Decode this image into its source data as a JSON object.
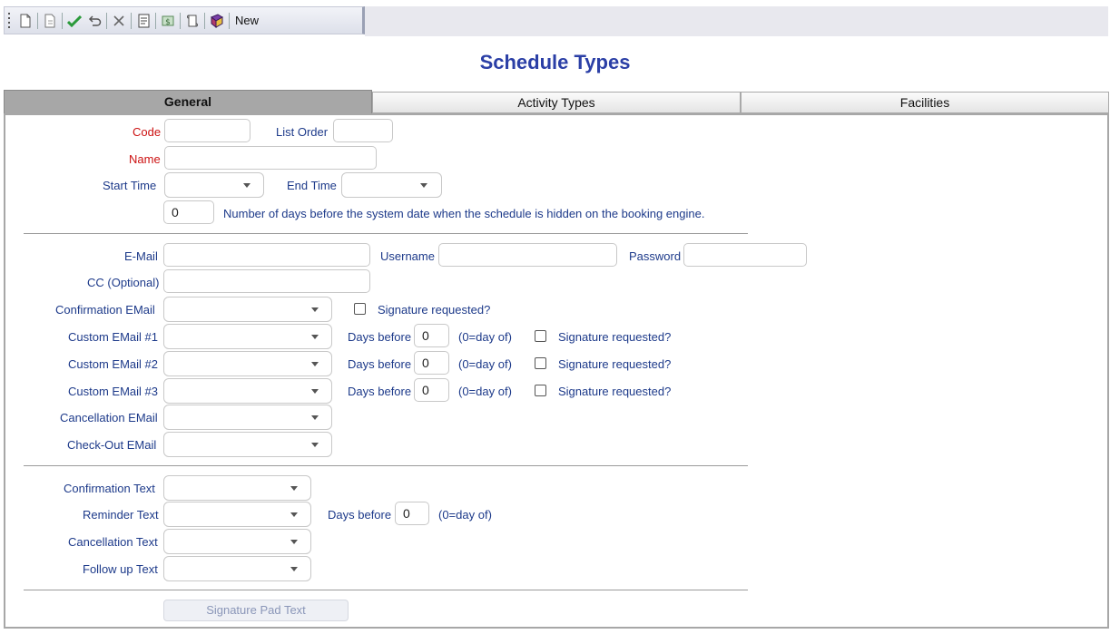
{
  "toolbar": {
    "icons": [
      "new-document-icon",
      "copy-document-icon",
      "save-check-icon",
      "undo-icon",
      "delete-icon",
      "report-icon",
      "money-icon",
      "history-icon",
      "help-book-icon"
    ],
    "new_label": "New"
  },
  "page_title": "Schedule Types",
  "tabs": [
    {
      "label": "General",
      "active": true
    },
    {
      "label": "Activity Types",
      "active": false
    },
    {
      "label": "Facilities",
      "active": false
    }
  ],
  "general": {
    "code_label": "Code",
    "list_order_label": "List Order",
    "name_label": "Name",
    "start_time_label": "Start Time",
    "end_time_label": "End Time",
    "hidden_days_value": "0",
    "hidden_days_text": "Number of days before the system date when the schedule is hidden on the booking engine.",
    "email_label": "E-Mail",
    "username_label": "Username",
    "password_label": "Password",
    "cc_label": "CC (Optional)",
    "confirmation_email_label": "Confirmation EMail",
    "signature_requested_label": "Signature requested?",
    "custom_emails": [
      {
        "label": "Custom EMail #1",
        "days_before_label": "Days before",
        "days_value": "0",
        "hint": "(0=day of)",
        "sig_label": "Signature requested?"
      },
      {
        "label": "Custom EMail #2",
        "days_before_label": "Days before",
        "days_value": "0",
        "hint": "(0=day of)",
        "sig_label": "Signature requested?"
      },
      {
        "label": "Custom EMail #3",
        "days_before_label": "Days before",
        "days_value": "0",
        "hint": "(0=day of)",
        "sig_label": "Signature requested?"
      }
    ],
    "cancellation_email_label": "Cancellation EMail",
    "checkout_email_label": "Check-Out EMail",
    "confirmation_text_label": "Confirmation Text",
    "reminder_text_label": "Reminder Text",
    "reminder_days_before_label": "Days before",
    "reminder_days_value": "0",
    "reminder_hint": "(0=day of)",
    "cancellation_text_label": "Cancellation Text",
    "follow_up_text_label": "Follow up Text",
    "signature_pad_button": "Signature Pad Text"
  }
}
